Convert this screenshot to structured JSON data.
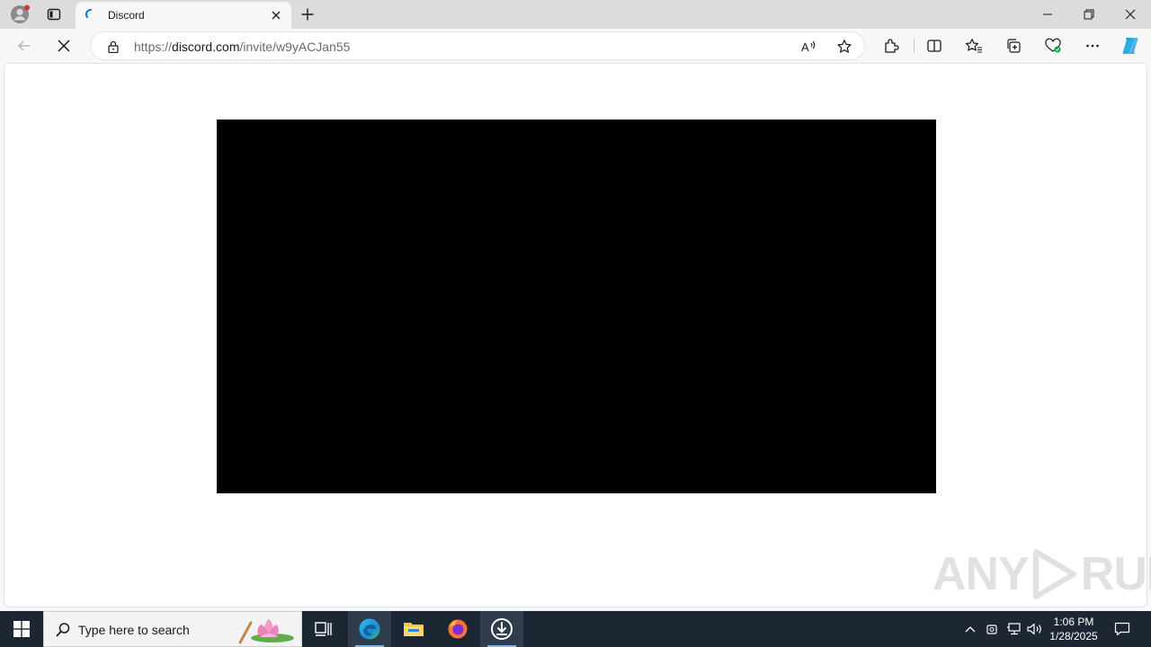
{
  "browser": {
    "tab": {
      "title": "Discord",
      "favicon": "discord-loading-icon"
    },
    "address": {
      "scheme": "https://",
      "host": "discord.com",
      "path": "/invite/w9yACJan55"
    },
    "toolbar_icons": [
      "back-icon",
      "stop-icon",
      "lock-icon",
      "read-aloud-icon",
      "favorite-star-icon",
      "extensions-icon",
      "split-screen-icon",
      "favorites-icon",
      "collections-icon",
      "browser-essentials-icon",
      "more-icon",
      "copilot-icon"
    ]
  },
  "page": {
    "watermark": {
      "left": "ANY",
      "right": "RUN"
    }
  },
  "taskbar": {
    "search_placeholder": "Type here to search",
    "apps": [
      "task-view-icon",
      "edge-icon",
      "file-explorer-icon",
      "firefox-icon",
      "downloader-icon"
    ],
    "clock": {
      "time": "1:06 PM",
      "date": "1/28/2025"
    }
  },
  "colors": {
    "accent": "#0078d4",
    "taskbar": "#1c2733",
    "video": "#000000"
  }
}
